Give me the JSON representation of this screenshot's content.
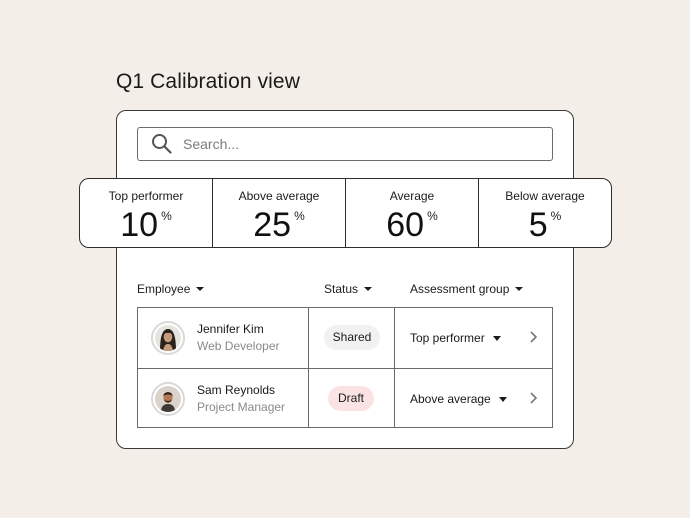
{
  "title": "Q1 Calibration view",
  "search": {
    "placeholder": "Search..."
  },
  "stats": [
    {
      "label": "Top performer",
      "value": "10",
      "unit": "%"
    },
    {
      "label": "Above average",
      "value": "25",
      "unit": "%"
    },
    {
      "label": "Average",
      "value": "60",
      "unit": "%"
    },
    {
      "label": "Below average",
      "value": "5",
      "unit": "%"
    }
  ],
  "table": {
    "columns": [
      "Employee",
      "Status",
      "Assessment group"
    ],
    "rows": [
      {
        "name": "Jennifer Kim",
        "role": "Web Developer",
        "status": "Shared",
        "group": "Top performer"
      },
      {
        "name": "Sam Reynolds",
        "role": "Project Manager",
        "status": "Draft",
        "group": "Above average"
      }
    ]
  },
  "colors": {
    "background": "#f4eee8",
    "shared_badge": "#f1f1f1",
    "draft_badge": "#fbe3e3"
  }
}
